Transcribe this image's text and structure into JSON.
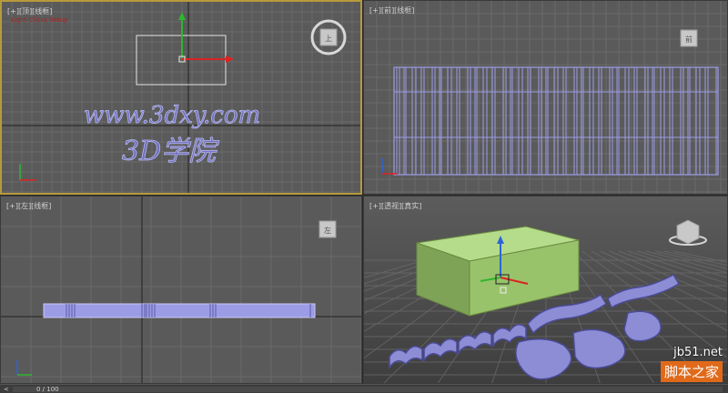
{
  "viewports": {
    "top": {
      "label": "[+][顶][线框]",
      "watermark_line1": "www.3dxy.com",
      "watermark_line2": "3D学院",
      "red_caption": "Light Clicks Setup"
    },
    "front": {
      "label": "[+][前][线框]"
    },
    "left": {
      "label": "[+][左][线框]"
    },
    "perspective": {
      "label": "[+][透视][真实]"
    }
  },
  "viewcube": {
    "top_face": "上",
    "front_face": "前",
    "left_face": "左"
  },
  "status": {
    "frame_counter": "0 / 100",
    "scroll_left": "<"
  },
  "site_watermark": {
    "domain": "jb51.net",
    "name": "脚本之家"
  },
  "colors": {
    "viewport_bg": "#5a5a5a",
    "active_border": "#b89a3c",
    "wire_color": "#9c9ce6",
    "box_color": "#9bc46a"
  }
}
